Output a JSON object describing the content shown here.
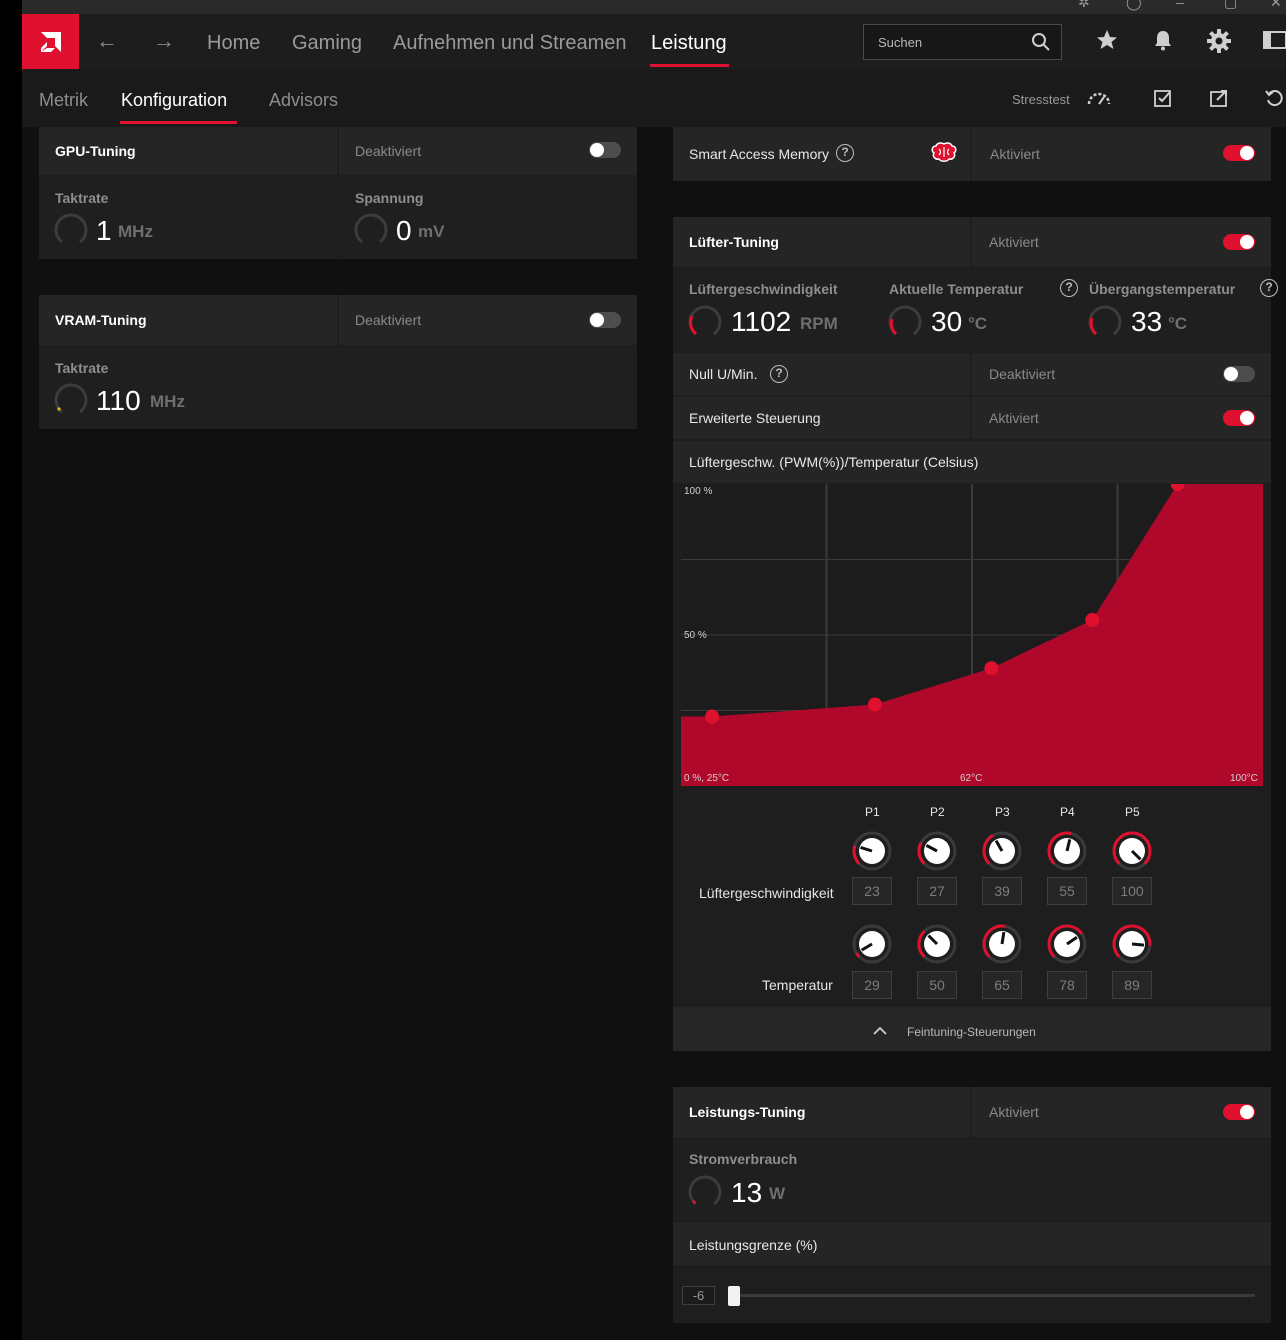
{
  "nav": {
    "items": [
      "Home",
      "Gaming",
      "Aufnehmen und Streamen",
      "Leistung"
    ],
    "search_placeholder": "Suchen"
  },
  "subnav": {
    "items": [
      "Metrik",
      "Konfiguration",
      "Advisors"
    ],
    "stress_label": "Stresstest"
  },
  "gpu_tuning": {
    "title": "GPU-Tuning",
    "state": "Deaktiviert",
    "enabled": false,
    "clock_label": "Taktrate",
    "clock_value": "1",
    "clock_unit": "MHz",
    "voltage_label": "Spannung",
    "voltage_value": "0",
    "voltage_unit": "mV"
  },
  "vram_tuning": {
    "title": "VRAM-Tuning",
    "state": "Deaktiviert",
    "enabled": false,
    "clock_label": "Taktrate",
    "clock_value": "110",
    "clock_unit": "MHz"
  },
  "sam": {
    "label": "Smart Access Memory",
    "state": "Aktiviert",
    "enabled": true
  },
  "fan_tuning": {
    "title": "Lüfter-Tuning",
    "state": "Aktiviert",
    "enabled": true,
    "speed_label": "Lüftergeschwindigkeit",
    "speed_value": "1102",
    "speed_unit": "RPM",
    "temp_label": "Aktuelle Temperatur",
    "temp_value": "30",
    "temp_unit": "°C",
    "junction_label": "Übergangstemperatur",
    "junction_value": "33",
    "junction_unit": "°C",
    "zero_rpm_label": "Null U/Min.",
    "zero_rpm_state": "Deaktiviert",
    "zero_rpm_enabled": false,
    "adv_label": "Erweiterte Steuerung",
    "adv_state": "Aktiviert",
    "adv_enabled": true,
    "curve_title": "Lüftergeschw. (PWM(%))/Temperatur (Celsius)",
    "y_top_label": "100 %",
    "y_mid_label": "50 %",
    "x_start_label": "0 %, 25°C",
    "x_mid_label": "62°C",
    "x_end_label": "100°C",
    "points": [
      "P1",
      "P2",
      "P3",
      "P4",
      "P5"
    ],
    "speed_row_label": "Lüftergeschwindigkeit",
    "speed_values": [
      "23",
      "27",
      "39",
      "55",
      "100"
    ],
    "temp_row_label": "Temperatur",
    "temp_values": [
      "29",
      "50",
      "65",
      "78",
      "89"
    ],
    "fine_label": "Feintuning-Steuerungen"
  },
  "power_tuning": {
    "title": "Leistungs-Tuning",
    "state": "Aktiviert",
    "enabled": true,
    "power_label": "Stromverbrauch",
    "power_value": "13",
    "power_unit": "W",
    "limit_label": "Leistungsgrenze (%)",
    "limit_value": "-6"
  },
  "colors": {
    "accent": "#e0102f",
    "chart_fill": "#b0082a"
  },
  "chart_data": {
    "type": "area",
    "title": "Lüftergeschw. (PWM(%))/Temperatur (Celsius)",
    "xlabel": "",
    "ylabel": "",
    "xlim": [
      25,
      100
    ],
    "ylim": [
      0,
      100
    ],
    "series": [
      {
        "x": [
          29,
          50,
          65,
          78,
          89
        ],
        "values": [
          23,
          27,
          39,
          55,
          100
        ]
      }
    ]
  }
}
